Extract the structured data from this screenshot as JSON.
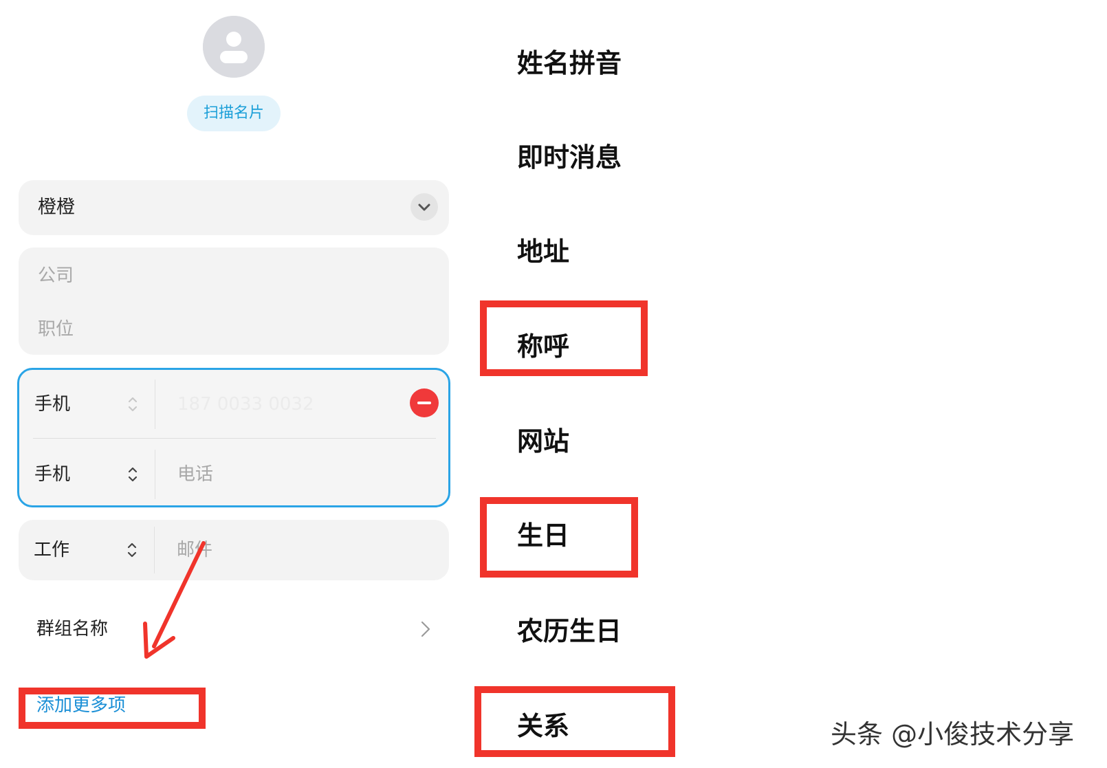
{
  "editor": {
    "scan_card_button": "扫描名片",
    "name_value": "橙橙",
    "company_placeholder": "公司",
    "position_placeholder": "职位",
    "phone_rows": [
      {
        "type": "手机",
        "value": "187 0033 0032"
      },
      {
        "type": "手机",
        "placeholder": "电话"
      }
    ],
    "email_row": {
      "type": "工作",
      "placeholder": "邮件"
    },
    "group_label": "群组名称",
    "add_more_label": "添加更多项"
  },
  "options": [
    "姓名拼音",
    "即时消息",
    "地址",
    "称呼",
    "网站",
    "生日",
    "农历生日",
    "关系"
  ],
  "watermark": "头条 @小俊技术分享",
  "colors": {
    "accent": "#1b9fd8",
    "focus_border": "#2aa4e6",
    "remove_button": "#f0393a",
    "annotation_red": "#f0342b"
  },
  "icons": {
    "avatar": "person-icon",
    "name_expand": "chevron-down-icon",
    "type_selector": "up-down-chevron-icon",
    "remove": "minus-circle-icon",
    "group_navigate": "chevron-right-icon"
  }
}
